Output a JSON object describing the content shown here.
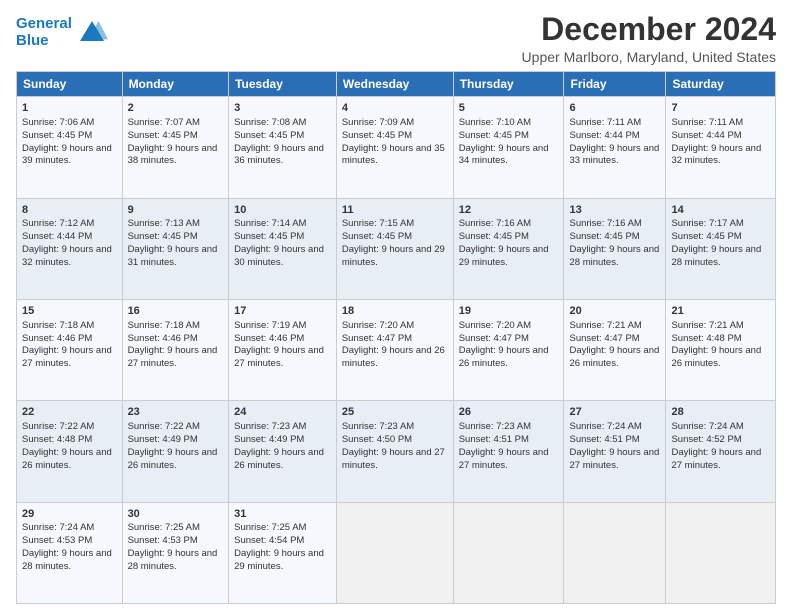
{
  "logo": {
    "line1": "General",
    "line2": "Blue"
  },
  "title": "December 2024",
  "subtitle": "Upper Marlboro, Maryland, United States",
  "days_of_week": [
    "Sunday",
    "Monday",
    "Tuesday",
    "Wednesday",
    "Thursday",
    "Friday",
    "Saturday"
  ],
  "weeks": [
    [
      {
        "day": 1,
        "rise": "7:06 AM",
        "set": "4:45 PM",
        "daylight": "9 hours and 39 minutes."
      },
      {
        "day": 2,
        "rise": "7:07 AM",
        "set": "4:45 PM",
        "daylight": "9 hours and 38 minutes."
      },
      {
        "day": 3,
        "rise": "7:08 AM",
        "set": "4:45 PM",
        "daylight": "9 hours and 36 minutes."
      },
      {
        "day": 4,
        "rise": "7:09 AM",
        "set": "4:45 PM",
        "daylight": "9 hours and 35 minutes."
      },
      {
        "day": 5,
        "rise": "7:10 AM",
        "set": "4:45 PM",
        "daylight": "9 hours and 34 minutes."
      },
      {
        "day": 6,
        "rise": "7:11 AM",
        "set": "4:44 PM",
        "daylight": "9 hours and 33 minutes."
      },
      {
        "day": 7,
        "rise": "7:11 AM",
        "set": "4:44 PM",
        "daylight": "9 hours and 32 minutes."
      }
    ],
    [
      {
        "day": 8,
        "rise": "7:12 AM",
        "set": "4:44 PM",
        "daylight": "9 hours and 32 minutes."
      },
      {
        "day": 9,
        "rise": "7:13 AM",
        "set": "4:45 PM",
        "daylight": "9 hours and 31 minutes."
      },
      {
        "day": 10,
        "rise": "7:14 AM",
        "set": "4:45 PM",
        "daylight": "9 hours and 30 minutes."
      },
      {
        "day": 11,
        "rise": "7:15 AM",
        "set": "4:45 PM",
        "daylight": "9 hours and 29 minutes."
      },
      {
        "day": 12,
        "rise": "7:16 AM",
        "set": "4:45 PM",
        "daylight": "9 hours and 29 minutes."
      },
      {
        "day": 13,
        "rise": "7:16 AM",
        "set": "4:45 PM",
        "daylight": "9 hours and 28 minutes."
      },
      {
        "day": 14,
        "rise": "7:17 AM",
        "set": "4:45 PM",
        "daylight": "9 hours and 28 minutes."
      }
    ],
    [
      {
        "day": 15,
        "rise": "7:18 AM",
        "set": "4:46 PM",
        "daylight": "9 hours and 27 minutes."
      },
      {
        "day": 16,
        "rise": "7:18 AM",
        "set": "4:46 PM",
        "daylight": "9 hours and 27 minutes."
      },
      {
        "day": 17,
        "rise": "7:19 AM",
        "set": "4:46 PM",
        "daylight": "9 hours and 27 minutes."
      },
      {
        "day": 18,
        "rise": "7:20 AM",
        "set": "4:47 PM",
        "daylight": "9 hours and 26 minutes."
      },
      {
        "day": 19,
        "rise": "7:20 AM",
        "set": "4:47 PM",
        "daylight": "9 hours and 26 minutes."
      },
      {
        "day": 20,
        "rise": "7:21 AM",
        "set": "4:47 PM",
        "daylight": "9 hours and 26 minutes."
      },
      {
        "day": 21,
        "rise": "7:21 AM",
        "set": "4:48 PM",
        "daylight": "9 hours and 26 minutes."
      }
    ],
    [
      {
        "day": 22,
        "rise": "7:22 AM",
        "set": "4:48 PM",
        "daylight": "9 hours and 26 minutes."
      },
      {
        "day": 23,
        "rise": "7:22 AM",
        "set": "4:49 PM",
        "daylight": "9 hours and 26 minutes."
      },
      {
        "day": 24,
        "rise": "7:23 AM",
        "set": "4:49 PM",
        "daylight": "9 hours and 26 minutes."
      },
      {
        "day": 25,
        "rise": "7:23 AM",
        "set": "4:50 PM",
        "daylight": "9 hours and 27 minutes."
      },
      {
        "day": 26,
        "rise": "7:23 AM",
        "set": "4:51 PM",
        "daylight": "9 hours and 27 minutes."
      },
      {
        "day": 27,
        "rise": "7:24 AM",
        "set": "4:51 PM",
        "daylight": "9 hours and 27 minutes."
      },
      {
        "day": 28,
        "rise": "7:24 AM",
        "set": "4:52 PM",
        "daylight": "9 hours and 27 minutes."
      }
    ],
    [
      {
        "day": 29,
        "rise": "7:24 AM",
        "set": "4:53 PM",
        "daylight": "9 hours and 28 minutes."
      },
      {
        "day": 30,
        "rise": "7:25 AM",
        "set": "4:53 PM",
        "daylight": "9 hours and 28 minutes."
      },
      {
        "day": 31,
        "rise": "7:25 AM",
        "set": "4:54 PM",
        "daylight": "9 hours and 29 minutes."
      },
      null,
      null,
      null,
      null
    ]
  ]
}
